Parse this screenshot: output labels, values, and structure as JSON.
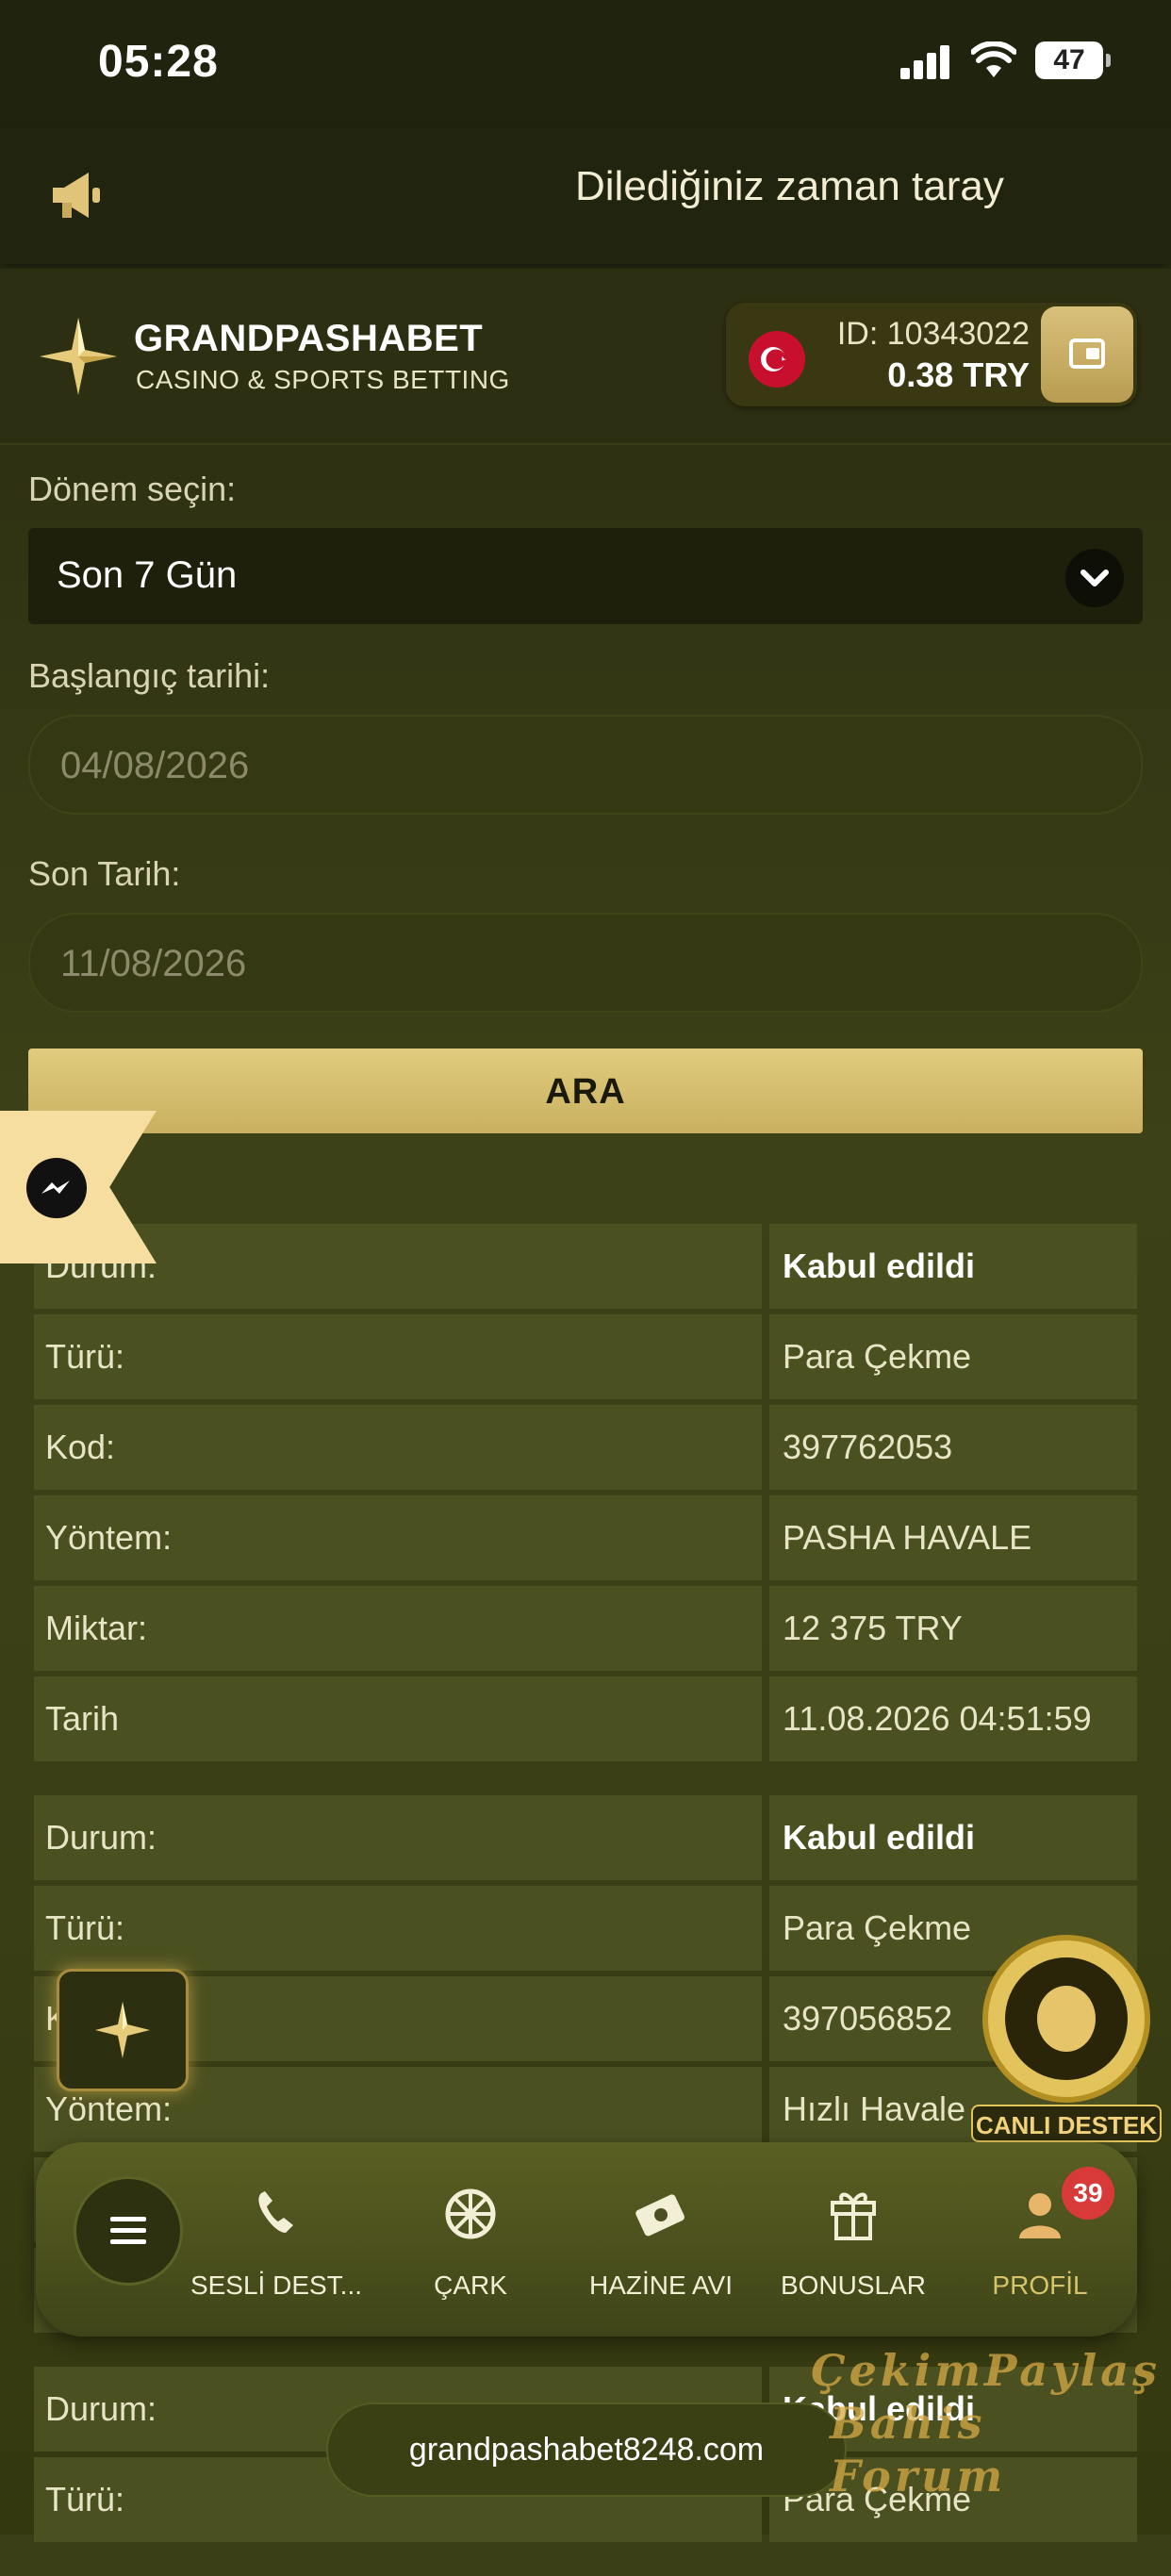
{
  "status_bar": {
    "time": "05:28",
    "battery": "47"
  },
  "announcement": {
    "text": "Dilediğiniz zaman taray"
  },
  "header": {
    "brand": "GRANDPASHABET",
    "brand_sub": "CASINO & SPORTS BETTING",
    "account_id": "ID: 10343022",
    "balance": "0.38   TRY"
  },
  "filters": {
    "period_label": "Dönem seçin:",
    "period_value": "Son 7 Gün",
    "start_label": "Başlangıç tarihi:",
    "start_value": "04/08/2026",
    "end_label": "Son Tarih:",
    "end_value": "11/08/2026",
    "search_button": "ARA"
  },
  "records": [
    {
      "rows": [
        {
          "key": "Durum:",
          "value": "Kabul edildi",
          "bold": true
        },
        {
          "key": "Türü:",
          "value": "Para Çekme"
        },
        {
          "key": "Kod:",
          "value": "397762053"
        },
        {
          "key": "Yöntem:",
          "value": "PASHA HAVALE"
        },
        {
          "key": "Miktar:",
          "value": "12 375 TRY"
        },
        {
          "key": "Tarih",
          "value": "11.08.2026 04:51:59"
        }
      ]
    },
    {
      "rows": [
        {
          "key": "Durum:",
          "value": "Kabul edildi",
          "bold": true
        },
        {
          "key": "Türü:",
          "value": "Para Çekme"
        },
        {
          "key": "K",
          "value": "397056852"
        },
        {
          "key": "Yöntem:",
          "value": "Hızlı Havale"
        },
        {
          "key": "",
          "value": ""
        },
        {
          "key": "",
          "value": ""
        }
      ]
    },
    {
      "rows": [
        {
          "key": "Durum:",
          "value": "Kabul edildi",
          "bold": true
        },
        {
          "key": "Türü:",
          "value": "Para Çekme"
        }
      ]
    }
  ],
  "support_label": "CANLI DESTEK",
  "nav": {
    "items": [
      {
        "label": "SESLİ DEST...",
        "icon": "phone-icon"
      },
      {
        "label": "ÇARK",
        "icon": "wheel-icon"
      },
      {
        "label": "HAZİNE AVI",
        "icon": "treasure-icon"
      },
      {
        "label": "BONUSLAR",
        "icon": "gift-icon"
      },
      {
        "label": "PROFİL",
        "icon": "user-icon",
        "badge": "39"
      }
    ]
  },
  "url": "grandpashabet8248.com",
  "watermark": {
    "line1": "ÇekimPaylaş",
    "line2": "Bahis Forum"
  },
  "colors": {
    "accent": "#d7c36b",
    "background": "#3b3f17",
    "badge": "#d83a3a"
  }
}
